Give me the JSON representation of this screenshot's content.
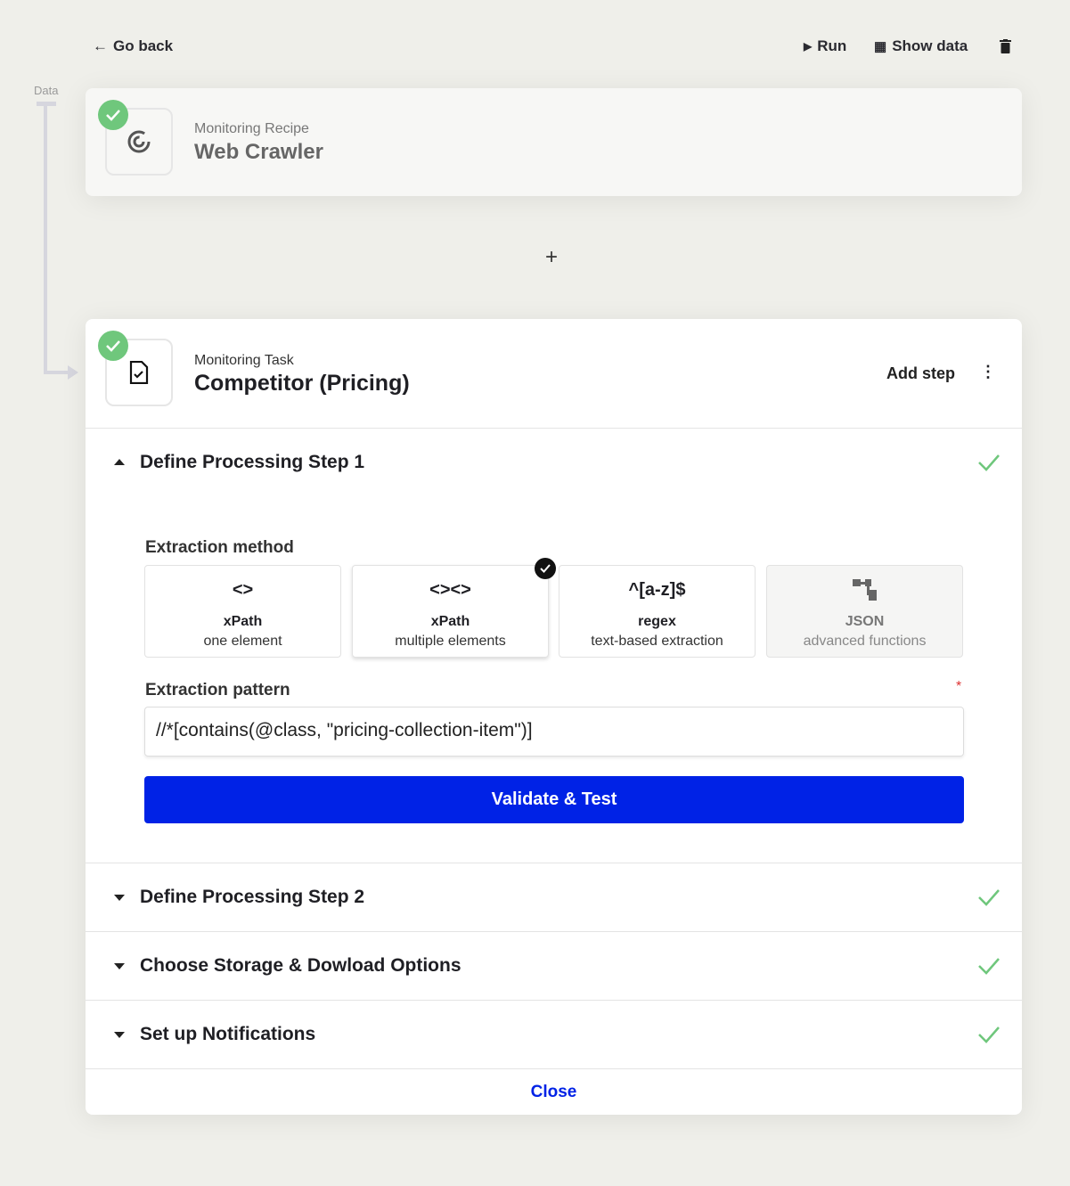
{
  "header": {
    "back_label": "Go back",
    "run_label": "Run",
    "show_data_label": "Show data"
  },
  "connector": {
    "label": "Data"
  },
  "recipe": {
    "subtitle": "Monitoring Recipe",
    "title": "Web Crawler"
  },
  "add_label": "+",
  "task": {
    "subtitle": "Monitoring Task",
    "title": "Competitor (Pricing)",
    "add_step_label": "Add step"
  },
  "step1": {
    "title": "Define Processing Step 1",
    "extraction_method_label": "Extraction method",
    "options": [
      {
        "icon": "<>",
        "name": "xPath",
        "desc": "one element",
        "selected": false,
        "disabled": false
      },
      {
        "icon": "<><>",
        "name": "xPath",
        "desc": "multiple elements",
        "selected": true,
        "disabled": false
      },
      {
        "icon": "^[a-z]$",
        "name": "regex",
        "desc": "text-based extraction",
        "selected": false,
        "disabled": false
      },
      {
        "icon": "json-tree-icon",
        "name": "JSON",
        "desc": "advanced functions",
        "selected": false,
        "disabled": true
      }
    ],
    "pattern_label": "Extraction pattern",
    "required_mark": "*",
    "pattern_value": "//*[contains(@class, \"pricing-collection-item\")]",
    "validate_label": "Validate & Test"
  },
  "sections": [
    {
      "title": "Define Processing Step 2"
    },
    {
      "title": "Choose Storage & Dowload Options"
    },
    {
      "title": "Set up Notifications"
    }
  ],
  "close_label": "Close",
  "colors": {
    "accent": "#0022e6",
    "success": "#6fc77c",
    "background": "#efefea"
  }
}
